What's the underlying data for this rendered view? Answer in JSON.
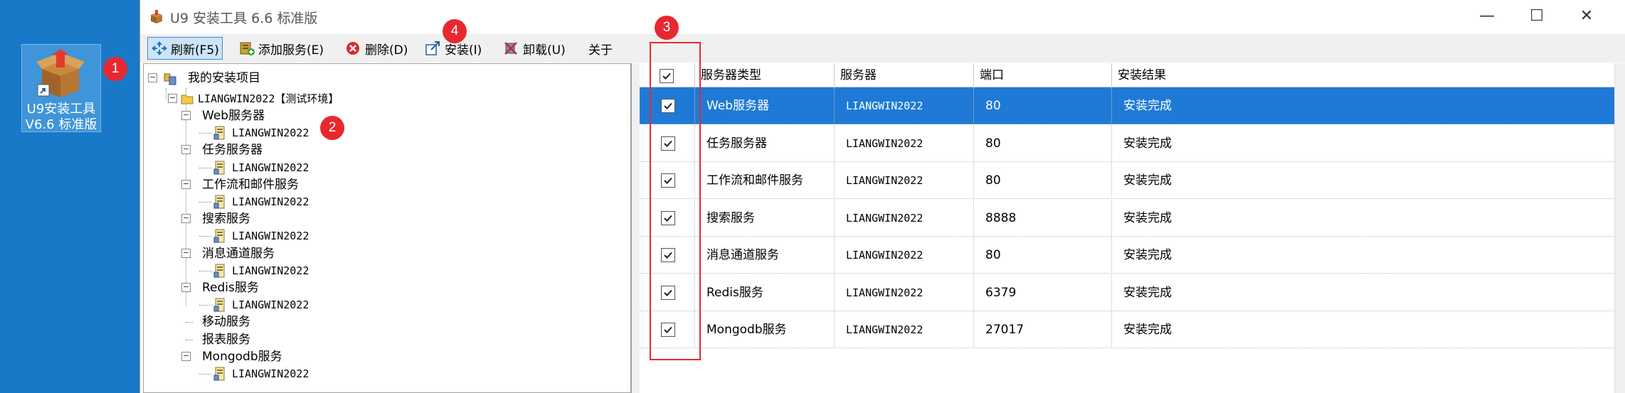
{
  "desktop": {
    "shortcut_label_line1": "U9安装工具",
    "shortcut_label_line2": "V6.6 标准版"
  },
  "markers": [
    "1",
    "2",
    "3",
    "4"
  ],
  "window": {
    "title": "U9 安装工具 6.6 标准版",
    "controls": {
      "minimize": "—",
      "maximize": "☐",
      "close": "✕"
    }
  },
  "toolbar": {
    "refresh": "刷新(F5)",
    "add_service": "添加服务(E)",
    "delete": "删除(D)",
    "install": "安装(I)",
    "uninstall": "卸载(U)",
    "about": "关于"
  },
  "tree": {
    "root": "我的安装项目",
    "machine": "LIANGWIN2022【测试环境】",
    "groups": [
      {
        "name": "Web服务器",
        "children": [
          "LIANGWIN2022"
        ]
      },
      {
        "name": "任务服务器",
        "children": [
          "LIANGWIN2022"
        ]
      },
      {
        "name": "工作流和邮件服务",
        "children": [
          "LIANGWIN2022"
        ]
      },
      {
        "name": "搜索服务",
        "children": [
          "LIANGWIN2022"
        ]
      },
      {
        "name": "消息通道服务",
        "children": [
          "LIANGWIN2022"
        ]
      },
      {
        "name": "Redis服务",
        "children": [
          "LIANGWIN2022"
        ]
      },
      {
        "name": "移动服务",
        "children": []
      },
      {
        "name": "报表服务",
        "children": []
      },
      {
        "name": "Mongodb服务",
        "children": [
          "LIANGWIN2022"
        ]
      }
    ]
  },
  "grid": {
    "columns": [
      "服务器类型",
      "服务器",
      "端口",
      "安装结果"
    ],
    "rows": [
      {
        "type": "Web服务器",
        "server": "LIANGWIN2022",
        "port": "80",
        "result": "安装完成",
        "checked": true,
        "selected": true
      },
      {
        "type": "任务服务器",
        "server": "LIANGWIN2022",
        "port": "80",
        "result": "安装完成",
        "checked": true,
        "selected": false
      },
      {
        "type": "工作流和邮件服务",
        "server": "LIANGWIN2022",
        "port": "80",
        "result": "安装完成",
        "checked": true,
        "selected": false
      },
      {
        "type": "搜索服务",
        "server": "LIANGWIN2022",
        "port": "8888",
        "result": "安装完成",
        "checked": true,
        "selected": false
      },
      {
        "type": "消息通道服务",
        "server": "LIANGWIN2022",
        "port": "80",
        "result": "安装完成",
        "checked": true,
        "selected": false
      },
      {
        "type": "Redis服务",
        "server": "LIANGWIN2022",
        "port": "6379",
        "result": "安装完成",
        "checked": true,
        "selected": false
      },
      {
        "type": "Mongodb服务",
        "server": "LIANGWIN2022",
        "port": "27017",
        "result": "安装完成",
        "checked": true,
        "selected": false
      }
    ]
  },
  "colors": {
    "desktop": "#1979c9",
    "selection": "#1e7ad6",
    "marker": "#e8282f"
  }
}
